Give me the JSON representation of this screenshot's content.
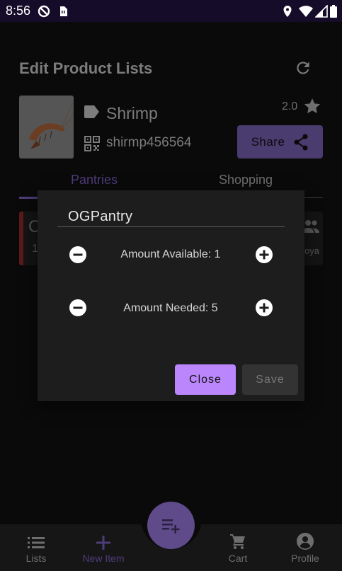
{
  "status_bar": {
    "time": "8:56"
  },
  "header": {
    "title": "Edit Product Lists"
  },
  "product": {
    "name": "Shrimp",
    "code": "shirmp456564",
    "rating": "2.0",
    "share_label": "Share"
  },
  "tabs": [
    {
      "label": "Pantries"
    },
    {
      "label": "Shopping"
    }
  ],
  "background_card": {
    "letter": "C",
    "count": "1",
    "owner_text": "oya"
  },
  "dialog": {
    "pantry_name": "OGPantry",
    "amount_available_label": "Amount Available: 1",
    "amount_needed_label": "Amount Needed: 5",
    "close_label": "Close",
    "save_label": "Save"
  },
  "bottom_nav": {
    "items": [
      {
        "label": "Lists",
        "icon": "list-icon"
      },
      {
        "label": "New Item",
        "icon": "plus-icon"
      },
      {
        "label": "Cart",
        "icon": "cart-icon"
      },
      {
        "label": "Profile",
        "icon": "profile-icon"
      }
    ],
    "fab_icon": "playlist-add-icon"
  },
  "colors": {
    "accent": "#bb86fc",
    "background": "#121212",
    "dialog": "#1d1d1d"
  }
}
